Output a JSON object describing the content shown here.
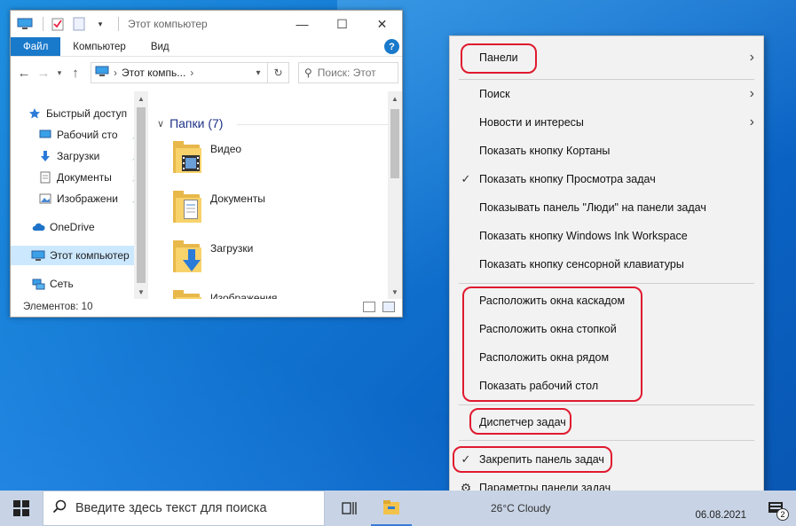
{
  "explorer": {
    "title": "Этот компьютер",
    "ribbon_tabs": [
      "Файл",
      "Компьютер",
      "Вид"
    ],
    "help_label": "?",
    "address": {
      "path": "Этот компь..."
    },
    "search_placeholder": "Поиск: Этот",
    "nav": [
      {
        "label": "Быстрый доступ",
        "icon": "star-icon",
        "pinned": false
      },
      {
        "label": "Рабочий сто",
        "icon": "desktop-icon",
        "pinned": true
      },
      {
        "label": "Загрузки",
        "icon": "download-arrow-icon",
        "pinned": true
      },
      {
        "label": "Документы",
        "icon": "document-icon",
        "pinned": true
      },
      {
        "label": "Изображени",
        "icon": "image-icon",
        "pinned": true
      },
      {
        "label": "OneDrive",
        "icon": "cloud-icon",
        "pinned": false
      },
      {
        "label": "Этот компьютер",
        "icon": "computer-icon",
        "pinned": false,
        "selected": true
      },
      {
        "label": "Сеть",
        "icon": "network-icon",
        "pinned": false
      }
    ],
    "group_title": "Папки (7)",
    "folders": [
      {
        "label": "Видео",
        "overlay": "film-icon"
      },
      {
        "label": "Документы",
        "overlay": "document-icon"
      },
      {
        "label": "Загрузки",
        "overlay": "download-arrow-icon"
      },
      {
        "label": "Изображения",
        "overlay": "image-icon"
      }
    ],
    "status": "Элементов: 10"
  },
  "context_menu": {
    "items": [
      {
        "label": "Панели",
        "submenu": true,
        "checked": false
      },
      {
        "label": "Поиск",
        "submenu": true,
        "checked": false
      },
      {
        "label": "Новости и интересы",
        "submenu": true,
        "checked": false
      },
      {
        "label": "Показать кнопку Кортаны",
        "submenu": false,
        "checked": false
      },
      {
        "label": "Показать кнопку Просмотра задач",
        "submenu": false,
        "checked": true
      },
      {
        "label": "Показывать панель \"Люди\" на панели задач",
        "submenu": false,
        "checked": false
      },
      {
        "label": "Показать кнопку Windows Ink Workspace",
        "submenu": false,
        "checked": false
      },
      {
        "label": "Показать кнопку сенсорной клавиатуры",
        "submenu": false,
        "checked": false
      },
      {
        "label": "Расположить окна каскадом",
        "submenu": false,
        "checked": false
      },
      {
        "label": "Расположить окна стопкой",
        "submenu": false,
        "checked": false
      },
      {
        "label": "Расположить окна рядом",
        "submenu": false,
        "checked": false
      },
      {
        "label": "Показать рабочий стол",
        "submenu": false,
        "checked": false
      },
      {
        "label": "Диспетчер задач",
        "submenu": false,
        "checked": false
      },
      {
        "label": "Закрепить панель задач",
        "submenu": false,
        "checked": true
      },
      {
        "label": "Параметры панели задач",
        "submenu": false,
        "checked": false,
        "icon": "gear-icon"
      }
    ],
    "highlight_color": "#e01a2e"
  },
  "taskbar": {
    "search_placeholder": "Введите здесь текст для поиска",
    "weather": "26°C  Cloudy",
    "date": "06.08.2021",
    "notification_count": "2"
  },
  "colors": {
    "accent": "#1979ca",
    "desktop": "#1479d3",
    "taskbar": "#c8d4e6",
    "nav_selected": "#cce8ff"
  }
}
